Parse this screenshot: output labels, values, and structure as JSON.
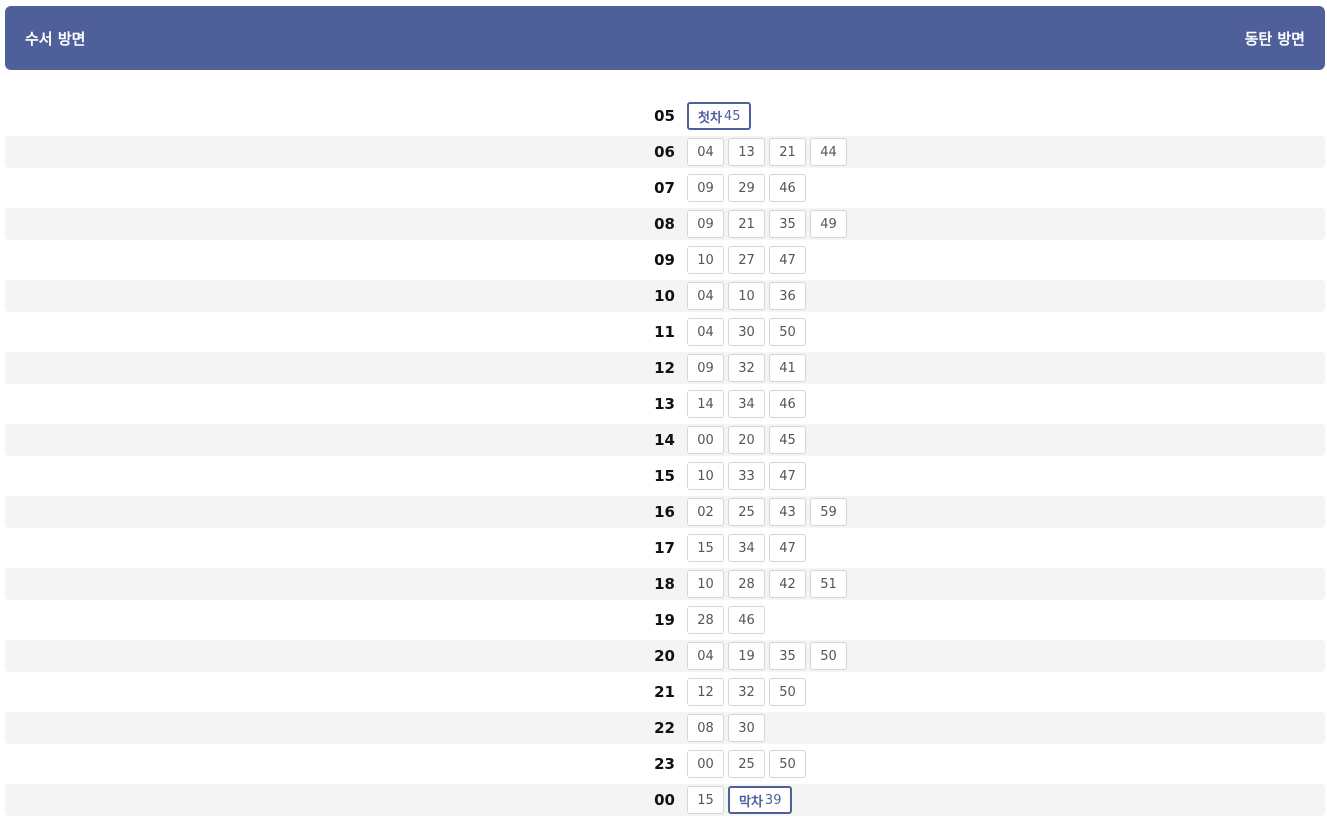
{
  "header": {
    "left_label": "수서 방면",
    "right_label": "동탄 방면"
  },
  "colors": {
    "header_bg": "#4f5f9a",
    "row_shade": "#f4f4f4",
    "chip_border": "#d5d5d5"
  },
  "rows": [
    {
      "hour": "05",
      "minutes": [
        {
          "tag": "첫차",
          "min": "45"
        }
      ]
    },
    {
      "hour": "06",
      "minutes": [
        {
          "min": "04"
        },
        {
          "min": "13"
        },
        {
          "min": "21"
        },
        {
          "min": "44"
        }
      ]
    },
    {
      "hour": "07",
      "minutes": [
        {
          "min": "09"
        },
        {
          "min": "29"
        },
        {
          "min": "46"
        }
      ]
    },
    {
      "hour": "08",
      "minutes": [
        {
          "min": "09"
        },
        {
          "min": "21"
        },
        {
          "min": "35"
        },
        {
          "min": "49"
        }
      ]
    },
    {
      "hour": "09",
      "minutes": [
        {
          "min": "10"
        },
        {
          "min": "27"
        },
        {
          "min": "47"
        }
      ]
    },
    {
      "hour": "10",
      "minutes": [
        {
          "min": "04"
        },
        {
          "min": "10"
        },
        {
          "min": "36"
        }
      ]
    },
    {
      "hour": "11",
      "minutes": [
        {
          "min": "04"
        },
        {
          "min": "30"
        },
        {
          "min": "50"
        }
      ]
    },
    {
      "hour": "12",
      "minutes": [
        {
          "min": "09"
        },
        {
          "min": "32"
        },
        {
          "min": "41"
        }
      ]
    },
    {
      "hour": "13",
      "minutes": [
        {
          "min": "14"
        },
        {
          "min": "34"
        },
        {
          "min": "46"
        }
      ]
    },
    {
      "hour": "14",
      "minutes": [
        {
          "min": "00"
        },
        {
          "min": "20"
        },
        {
          "min": "45"
        }
      ]
    },
    {
      "hour": "15",
      "minutes": [
        {
          "min": "10"
        },
        {
          "min": "33"
        },
        {
          "min": "47"
        }
      ]
    },
    {
      "hour": "16",
      "minutes": [
        {
          "min": "02"
        },
        {
          "min": "25"
        },
        {
          "min": "43"
        },
        {
          "min": "59"
        }
      ]
    },
    {
      "hour": "17",
      "minutes": [
        {
          "min": "15"
        },
        {
          "min": "34"
        },
        {
          "min": "47"
        }
      ]
    },
    {
      "hour": "18",
      "minutes": [
        {
          "min": "10"
        },
        {
          "min": "28"
        },
        {
          "min": "42"
        },
        {
          "min": "51"
        }
      ]
    },
    {
      "hour": "19",
      "minutes": [
        {
          "min": "28"
        },
        {
          "min": "46"
        }
      ]
    },
    {
      "hour": "20",
      "minutes": [
        {
          "min": "04"
        },
        {
          "min": "19"
        },
        {
          "min": "35"
        },
        {
          "min": "50"
        }
      ]
    },
    {
      "hour": "21",
      "minutes": [
        {
          "min": "12"
        },
        {
          "min": "32"
        },
        {
          "min": "50"
        }
      ]
    },
    {
      "hour": "22",
      "minutes": [
        {
          "min": "08"
        },
        {
          "min": "30"
        }
      ]
    },
    {
      "hour": "23",
      "minutes": [
        {
          "min": "00"
        },
        {
          "min": "25"
        },
        {
          "min": "50"
        }
      ]
    },
    {
      "hour": "00",
      "minutes": [
        {
          "min": "15"
        },
        {
          "tag": "막차",
          "min": "39"
        }
      ]
    }
  ]
}
